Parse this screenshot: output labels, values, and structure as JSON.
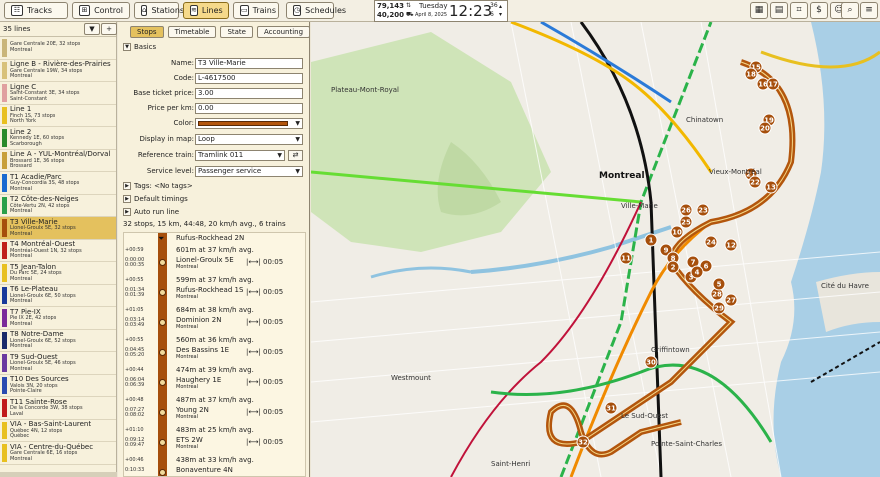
{
  "toolbar": {
    "buttons": [
      {
        "label": "Tracks",
        "icon": "tracks-icon",
        "active": false
      },
      {
        "label": "Control",
        "icon": "control-icon",
        "active": false
      },
      {
        "label": "Stations",
        "icon": "stations-icon",
        "active": false
      },
      {
        "label": "Lines",
        "icon": "lines-icon",
        "active": true
      },
      {
        "label": "Trains",
        "icon": "trains-icon",
        "active": false
      },
      {
        "label": "Schedules",
        "icon": "schedules-icon",
        "active": false
      }
    ],
    "stats": {
      "money": "79,143",
      "passengers": "40,200"
    },
    "date": {
      "weekday": "Tuesday",
      "date": "April 8, 2025"
    },
    "clock": "12:23",
    "clock_sub": {
      "speed": "36",
      "second": "6"
    }
  },
  "lines_panel": {
    "count_label": "35 lines",
    "items": [
      {
        "name": "",
        "sub1": "Gare Centrale 20E, 32 stops",
        "sub2": "Montreal",
        "color": "#c9b57a"
      },
      {
        "name": "Ligne B - Rivière-des-Prairies",
        "sub1": "Gare Centrale 19W, 34 stops",
        "sub2": "Montreal",
        "color": "#d8c17a"
      },
      {
        "name": "Ligne C",
        "sub1": "Saint-Constant 3E, 34 stops",
        "sub2": "Saint-Constant",
        "color": "#e0a0a0"
      },
      {
        "name": "Line 1",
        "sub1": "Finch 1S, 73 stops",
        "sub2": "North York",
        "color": "#e8c020"
      },
      {
        "name": "Line 2",
        "sub1": "Kennedy 1E, 60 stops",
        "sub2": "Scarborough",
        "color": "#2a8a2a"
      },
      {
        "name": "Line A - YUL-Montréal/Dorval",
        "sub1": "Brossard 1E, 36 stops",
        "sub2": "Brossard",
        "color": "#c8a03a"
      },
      {
        "name": "T1 Acadie/Parc",
        "sub1": "Guy-Concordia 3S, 48 stops",
        "sub2": "Montreal",
        "color": "#1a6ad0"
      },
      {
        "name": "T2 Côte-des-Neiges",
        "sub1": "Côte-Vertu 2N, 42 stops",
        "sub2": "Montreal",
        "color": "#2aa04a"
      },
      {
        "name": "T3 Ville-Marie",
        "sub1": "Lionel-Groulx 5E, 32 stops",
        "sub2": "Montreal",
        "color": "#a64f0c",
        "selected": true
      },
      {
        "name": "T4 Montréal-Ouest",
        "sub1": "Montréal-Ouest 1N, 32 stops",
        "sub2": "Montreal",
        "color": "#c0201a"
      },
      {
        "name": "T5 Jean-Talon",
        "sub1": "Du Parc 5E, 24 stops",
        "sub2": "Montreal",
        "color": "#e8c020"
      },
      {
        "name": "T6 Le-Plateau",
        "sub1": "Lionel-Groulx 6E, 50 stops",
        "sub2": "Montreal",
        "color": "#1a3a9a"
      },
      {
        "name": "T7 Pie-IX",
        "sub1": "Pie IX 2E, 42 stops",
        "sub2": "Montreal",
        "color": "#7a2a9a"
      },
      {
        "name": "T8 Notre-Dame",
        "sub1": "Lionel-Groulx 6E, 52 stops",
        "sub2": "Montreal",
        "color": "#1a2a6a"
      },
      {
        "name": "T9 Sud-Ouest",
        "sub1": "Lionel-Groulx 5E, 46 stops",
        "sub2": "Montreal",
        "color": "#6a3aa0"
      },
      {
        "name": "T10 Des Sources",
        "sub1": "Valois 3N, 20 stops",
        "sub2": "Pointe-Claire",
        "color": "#2a4ab0"
      },
      {
        "name": "T11 Sainte-Rose",
        "sub1": "De la Concorde 3W, 38 stops",
        "sub2": "Laval",
        "color": "#c01a1a"
      },
      {
        "name": "VIA - Bas-Saint-Laurent",
        "sub1": "Québec 4N, 12 stops",
        "sub2": "Québec",
        "color": "#e8c020"
      },
      {
        "name": "VIA - Centre-du-Québec",
        "sub1": "Gare Centrale 6E, 16 stops",
        "sub2": "Montreal",
        "color": "#e8c020"
      }
    ]
  },
  "editor": {
    "tabs": [
      "Stops",
      "Timetable",
      "State",
      "Accounting"
    ],
    "active_tab": "Stops",
    "basics_label": "Basics",
    "fields": {
      "name_label": "Name:",
      "name_value": "T3 Ville-Marie",
      "code_label": "Code:",
      "code_value": "L-4617500",
      "base_ticket_label": "Base ticket price:",
      "base_ticket_value": "3.00",
      "price_km_label": "Price per km:",
      "price_km_value": "0.00",
      "color_label": "Color:",
      "color_value": "#b3560d",
      "display_label": "Display in map:",
      "display_value": "Loop",
      "ref_train_label": "Reference train:",
      "ref_train_value": "Tramlink 011",
      "service_label": "Service level:",
      "service_value": "Passenger service"
    },
    "tags_label": "Tags: <No tags>",
    "default_timings_label": "Default timings",
    "auto_run_label": "Auto run line",
    "summary": "32 stops, 15 km, 44:48, 20 km/h avg., 6 trains"
  },
  "timeline": {
    "header": "Rufus-Rockhead 2N",
    "rows": [
      {
        "kind": "seg",
        "time": "+00:59",
        "text": "601m at 37 km/h avg."
      },
      {
        "kind": "stop",
        "t1": "0:00:00",
        "t2": "0:00:35",
        "name": "Lionel-Groulx 5E",
        "sub": "Montreal",
        "dwell": "00:05"
      },
      {
        "kind": "seg",
        "time": "+00:55",
        "text": "599m at 37 km/h avg."
      },
      {
        "kind": "stop",
        "t1": "0:01:34",
        "t2": "0:01:39",
        "name": "Rufus-Rockhead 1S",
        "sub": "Montreal",
        "dwell": "00:05"
      },
      {
        "kind": "seg",
        "time": "+01:05",
        "text": "684m at 38 km/h avg."
      },
      {
        "kind": "stop",
        "t1": "0:03:14",
        "t2": "0:03:49",
        "name": "Dominion 2N",
        "sub": "Montreal",
        "dwell": "00:05"
      },
      {
        "kind": "seg",
        "time": "+00:55",
        "text": "560m at 36 km/h avg."
      },
      {
        "kind": "stop",
        "t1": "0:04:45",
        "t2": "0:05:20",
        "name": "Des Bassins 1E",
        "sub": "Montreal",
        "dwell": "00:05"
      },
      {
        "kind": "seg",
        "time": "+00:44",
        "text": "474m at 39 km/h avg."
      },
      {
        "kind": "stop",
        "t1": "0:06:04",
        "t2": "0:06:39",
        "name": "Haughery 1E",
        "sub": "Montreal",
        "dwell": "00:05"
      },
      {
        "kind": "seg",
        "time": "+00:48",
        "text": "487m at 37 km/h avg."
      },
      {
        "kind": "stop",
        "t1": "0:07:27",
        "t2": "0:08:02",
        "name": "Young 2N",
        "sub": "Montreal",
        "dwell": "00:05"
      },
      {
        "kind": "seg",
        "time": "+01:10",
        "text": "483m at 25 km/h avg."
      },
      {
        "kind": "stop",
        "t1": "0:09:12",
        "t2": "0:09:47",
        "name": "ETS 2W",
        "sub": "Montreal",
        "dwell": "00:05"
      },
      {
        "kind": "seg",
        "time": "+00:46",
        "text": "438m at 33 km/h avg."
      },
      {
        "kind": "stop",
        "t1": "0:10:33",
        "t2": "",
        "name": "Bonaventure 4N",
        "sub": "",
        "dwell": ""
      }
    ]
  },
  "map": {
    "labels": {
      "montreal": "Montreal",
      "westmount": "Westmount",
      "ville_marie": "Ville-Marie",
      "le_sud_ouest": "Le Sud-Ouest",
      "cite_du_havre": "Cité du Havre",
      "vieux_montreal": "Vieux-Montréal",
      "chinatown": "Chinatown",
      "pointe_saint_charles": "Pointe-Saint-Charles",
      "saint_henri": "Saint-Henri",
      "griffintown": "Griffintown",
      "plateau": "Plateau-Mont-Royal"
    },
    "stop_numbers": [
      "15",
      "16",
      "18",
      "17",
      "19",
      "20",
      "21",
      "13",
      "22",
      "26",
      "25",
      "23",
      "24",
      "28",
      "27",
      "29",
      "10",
      "9",
      "8",
      "7",
      "6",
      "5",
      "3",
      "2",
      "1",
      "4",
      "32",
      "31",
      "30",
      "11",
      "12"
    ]
  }
}
